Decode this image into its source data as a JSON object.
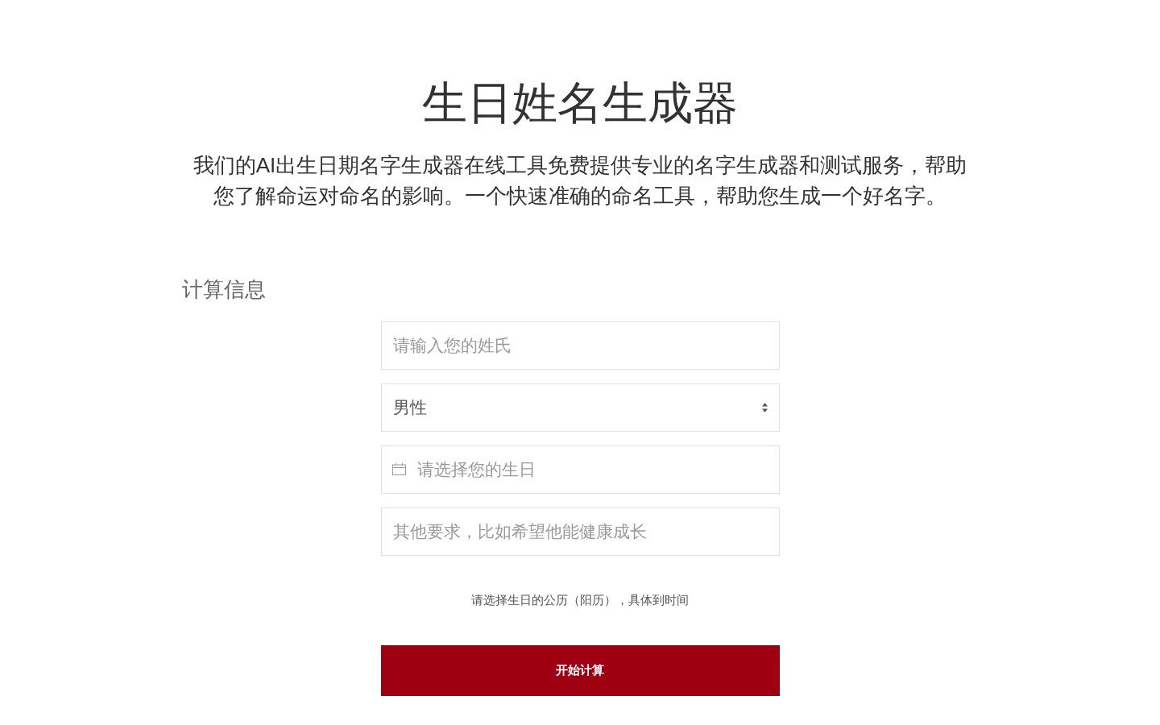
{
  "title": "生日姓名生成器",
  "description": "我们的AI出生日期名字生成器在线工具免费提供专业的名字生成器和测试服务，帮助您了解命运对命名的影响。一个快速准确的命名工具，帮助您生成一个好名字。",
  "form": {
    "section_title": "计算信息",
    "fields": [
      {
        "kind": "text",
        "placeholder": "请输入您的姓氏"
      },
      {
        "kind": "select",
        "value": "男性"
      },
      {
        "kind": "date",
        "placeholder": "请选择您的生日"
      },
      {
        "kind": "text",
        "placeholder": "其他要求，比如希望他能健康成长"
      }
    ],
    "note": "请选择生日的公历（阳历），具体到时间",
    "submit": "开始计算"
  }
}
